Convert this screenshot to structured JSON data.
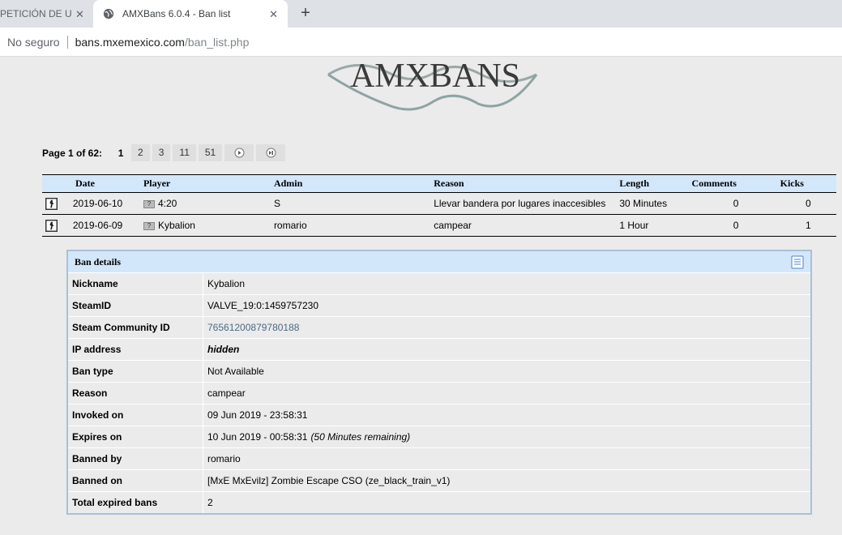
{
  "browser": {
    "prev_tab_title": "PETICIÓN DE UNA",
    "active_tab_title": "AMXBans 6.0.4 - Ban list",
    "security_label": "No seguro",
    "url_host": "bans.mxemexico.com",
    "url_path": "/ban_list.php"
  },
  "logo": {
    "text": "AMXBANS"
  },
  "pagination": {
    "label": "Page 1 of 62:",
    "current": "1",
    "pages": [
      "2",
      "3",
      "11",
      "51"
    ]
  },
  "ban_table": {
    "columns": [
      "Date",
      "Player",
      "Admin",
      "Reason",
      "Length",
      "Comments",
      "Kicks"
    ],
    "rows": [
      {
        "date": "2019-06-10",
        "player": "4:20",
        "admin": "S",
        "reason": "Llevar bandera por lugares inaccesibles",
        "length": "30 Minutes",
        "comments": "0",
        "kicks": "0"
      },
      {
        "date": "2019-06-09",
        "player": "Kybalion",
        "admin": "romario",
        "reason": "campear",
        "length": "1 Hour",
        "comments": "0",
        "kicks": "1"
      }
    ]
  },
  "details": {
    "title": "Ban details",
    "fields": [
      {
        "label": "Nickname",
        "value": "Kybalion"
      },
      {
        "label": "SteamID",
        "value": "VALVE_19:0:1459757230"
      },
      {
        "label": "Steam Community ID",
        "value": "76561200879780188"
      },
      {
        "label": "IP address",
        "value": "hidden"
      },
      {
        "label": "Ban type",
        "value": "Not Available"
      },
      {
        "label": "Reason",
        "value": "campear"
      },
      {
        "label": "Invoked on",
        "value": "09 Jun 2019 - 23:58:31"
      },
      {
        "label": "Expires on",
        "value": "10 Jun 2019 - 00:58:31",
        "note": "(50 Minutes remaining)"
      },
      {
        "label": "Banned by",
        "value": "romario"
      },
      {
        "label": "Banned on",
        "value": "[MxE MxEvilz] Zombie Escape CSO (ze_black_train_v1)"
      },
      {
        "label": "Total expired bans",
        "value": "2"
      }
    ]
  }
}
